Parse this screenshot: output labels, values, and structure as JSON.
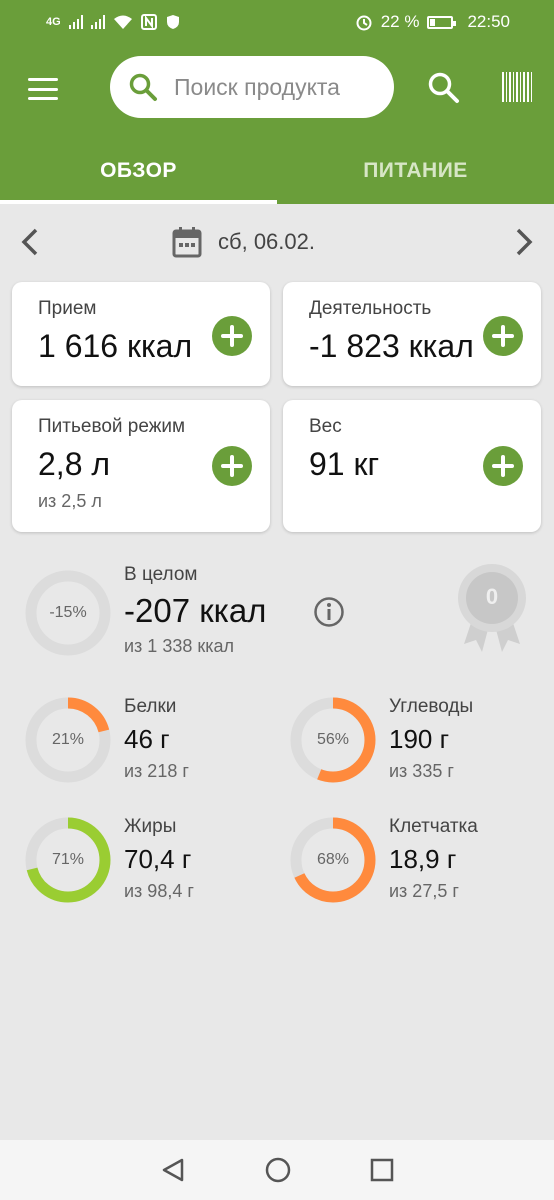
{
  "status_bar": {
    "network": "4G",
    "battery": "22 %",
    "time": "22:50"
  },
  "search": {
    "placeholder": "Поиск продукта"
  },
  "tabs": [
    {
      "label": "ОБЗОР",
      "active": true
    },
    {
      "label": "ПИТАНИЕ",
      "active": false
    }
  ],
  "date": {
    "label": "сб, 06.02."
  },
  "cards": {
    "intake": {
      "label": "Прием",
      "value": "1 616 ккал"
    },
    "activity": {
      "label": "Деятельность",
      "value": "-1 823 ккал"
    },
    "water": {
      "label": "Питьевой режим",
      "value": "2,8 л",
      "sub": "из 2,5 л"
    },
    "weight": {
      "label": "Вес",
      "value": "91 кг"
    }
  },
  "overall": {
    "label": "В целом",
    "value": "-207 ккал",
    "sub": "из 1 338 ккал",
    "pct_label": "-15%",
    "pct": 0,
    "badge": "0"
  },
  "macros": {
    "protein": {
      "label": "Белки",
      "value": "46 г",
      "sub": "из 218 г",
      "pct_label": "21%",
      "pct": 0.21,
      "color": "#ff8a3d"
    },
    "carbs": {
      "label": "Углеводы",
      "value": "190 г",
      "sub": "из 335 г",
      "pct_label": "56%",
      "pct": 0.56,
      "color": "#ff8a3d"
    },
    "fat": {
      "label": "Жиры",
      "value": "70,4 г",
      "sub": "из 98,4 г",
      "pct_label": "71%",
      "pct": 0.71,
      "color": "#9acd32"
    },
    "fiber": {
      "label": "Клетчатка",
      "value": "18,9 г",
      "sub": "из 27,5 г",
      "pct_label": "68%",
      "pct": 0.68,
      "color": "#ff8a3d"
    }
  },
  "colors": {
    "brand": "#6a9e3a",
    "ring_track": "#dcdcdc"
  }
}
